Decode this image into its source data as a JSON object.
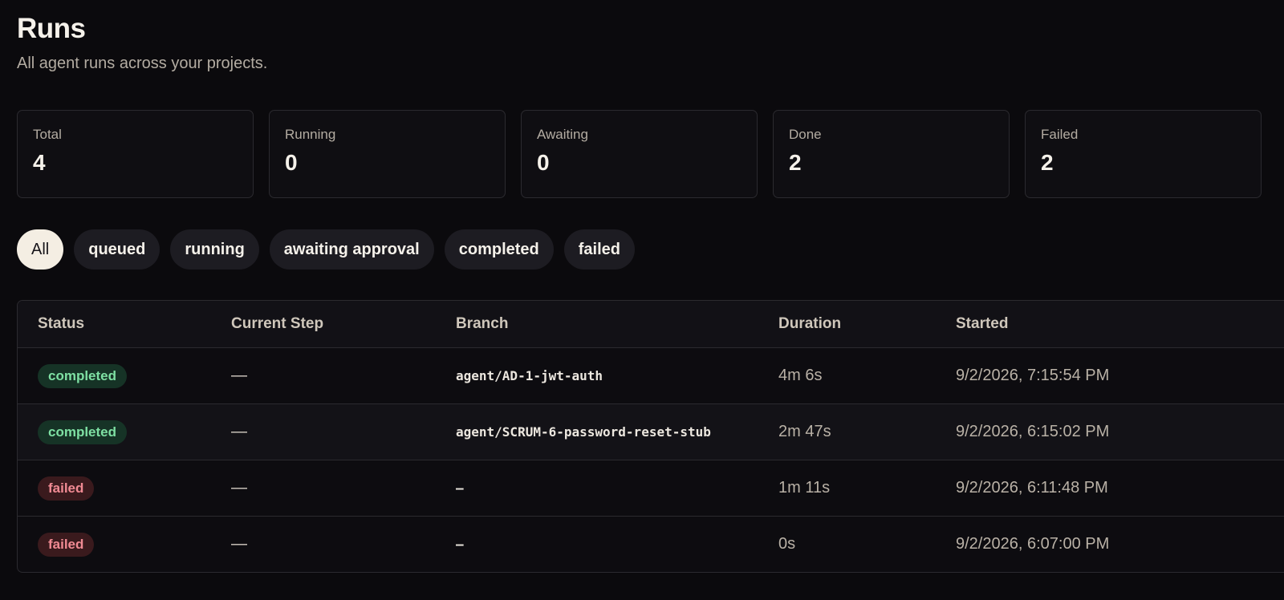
{
  "header": {
    "title": "Runs",
    "subtitle": "All agent runs across your projects."
  },
  "stats": [
    {
      "label": "Total",
      "value": "4"
    },
    {
      "label": "Running",
      "value": "0"
    },
    {
      "label": "Awaiting",
      "value": "0"
    },
    {
      "label": "Done",
      "value": "2"
    },
    {
      "label": "Failed",
      "value": "2"
    }
  ],
  "filters": [
    {
      "label": "All",
      "active": true
    },
    {
      "label": "queued",
      "active": false
    },
    {
      "label": "running",
      "active": false
    },
    {
      "label": "awaiting approval",
      "active": false
    },
    {
      "label": "completed",
      "active": false
    },
    {
      "label": "failed",
      "active": false
    }
  ],
  "table": {
    "columns": [
      "Status",
      "Current Step",
      "Branch",
      "Duration",
      "Started"
    ],
    "rows": [
      {
        "status": "completed",
        "step": "—",
        "branch": "agent/AD-1-jwt-auth",
        "duration": "4m 6s",
        "started": "9/2/2026, 7:15:54 PM"
      },
      {
        "status": "completed",
        "step": "—",
        "branch": "agent/SCRUM-6-password-reset-stub",
        "duration": "2m 47s",
        "started": "9/2/2026, 6:15:02 PM"
      },
      {
        "status": "failed",
        "step": "—",
        "branch": "–",
        "duration": "1m 11s",
        "started": "9/2/2026, 6:11:48 PM"
      },
      {
        "status": "failed",
        "step": "—",
        "branch": "–",
        "duration": "0s",
        "started": "9/2/2026, 6:07:00 PM"
      }
    ]
  },
  "colors": {
    "background": "#0b0a0d",
    "completed_badge_bg": "#163326",
    "completed_badge_text": "#7ee0a3",
    "failed_badge_bg": "#3a1a1d",
    "failed_badge_text": "#f08a93",
    "active_filter_bg": "#f4eee3"
  }
}
